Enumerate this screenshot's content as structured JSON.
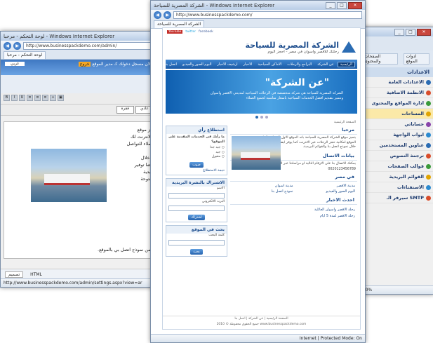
{
  "left_window": {
    "title": "لوحة التحكم - مرحبا - Windows Internet Explorer",
    "address": "http://www.businesspackdemo.com/admin/",
    "tab_label": "http://www.businesspackdemo.com",
    "tab2_label": "لوحة التحكم - مرحبا",
    "language_value": "عربي",
    "logged_in_text": "انت الان مسجل دخولك كـ مدير الموقع",
    "logout_label": "خروج",
    "format_value": "فقرة",
    "font_value": "خط عادي",
    "editor_lines": [
      "يتميز موقع",
      "ثر الانترنت لك",
      "بالعملاء للتواصل",
      "يتم ",
      "من خلال",
      "و ايضا توفير",
      "البريدية",
      "المفتوحة"
    ],
    "editor_footer": "الة من نموذج اتصل بي بالموقع.",
    "bottom_tabs": [
      "تصميم",
      "HTML"
    ],
    "status_url": "http://www.businesspackdemo.com/admin/settings.aspx?view=ar"
  },
  "right_window": {
    "menu": [
      "الصفحات والمحتوى",
      "ادوات الموقع"
    ],
    "section_title": "الاعدادات",
    "items": [
      {
        "label": "الاعدادات العامة",
        "color": "#2b6cb3"
      },
      {
        "label": "الانظمة الاضافية",
        "color": "#d94c2a"
      },
      {
        "label": "ادارة المواقع والمحتوى",
        "color": "#3a9a3a"
      },
      {
        "label": "المساحات",
        "color": "#e0a400"
      },
      {
        "label": "حساباتي",
        "color": "#8844aa"
      },
      {
        "label": "ابواب الواجهة",
        "color": "#2b8ad0"
      },
      {
        "label": "عناوين المستخدمين",
        "color": "#2b6cb3"
      },
      {
        "label": "ترجمة النصوص",
        "color": "#d94c2a"
      },
      {
        "label": "قوالب الصفحات",
        "color": "#3a9a3a"
      },
      {
        "label": "القوائم البريدية",
        "color": "#e0a400"
      },
      {
        "label": "الاستفتاءات",
        "color": "#2b8ad0"
      },
      {
        "label": "سيرفر الـ SMTP",
        "color": "#d94c2a"
      }
    ],
    "zoom": "100%"
  },
  "main_window": {
    "title": "الشركة المصرية للسياحة - Windows Internet Explorer",
    "address": "http://www.businesspackdemo.com/",
    "tab_label": "الشركة المصرية للسياحة",
    "site": {
      "social": [
        "YouTube",
        "twitter",
        "facebook"
      ],
      "logo_title": "الشركة المصرية للسياحة",
      "logo_sub": "رحلتك للاقصر واسوان في مصر - احجز اليوم",
      "nav": [
        "الرئيسية",
        "عن الشركة",
        "البرامج والرحلات",
        "الاماكن السياحية",
        "الاخبار",
        "ارشيف الاخبار",
        "البوم الصور والفيديو",
        "اتصل بنا"
      ],
      "hero_title": "\"عن الشركة\"",
      "hero_text": "الشركة المصرية للسياحة هي شركة متخصصة في الرحلات السياحية لمدينتي الاقصر واسوان ونتميز بتقديم افضل الخدمات السياحية باسعار مناسبة لجميع العملاء",
      "breadcrumb": "الصفحة الرئيسية",
      "welcome_title": "مرحبا",
      "welcome_text": "يتميز موقع الشركة المصرية للسياحة بانه الموقع الاول للرحلات النيلية في مصر ويوفر الموقع امكانية حجز الرحلات عبر الانترنت كما يوفر ايضا وسائل التواصل مع العملاء من خلال نموذج اتصل بنا والقوائم البريدية.",
      "contact_title": "بيانات الاتصال",
      "contact_text": "يمكنك الاتصال بنا على الارقام التالية او مراسلتنا عبر البريد الالكتروني",
      "phone": "0020123456789",
      "cities_title": "في مصر",
      "cities": [
        "مدينة الاقصر",
        "مدينة اسوان",
        "البوم الصور والفيديو",
        "نموذج اتصل بنا"
      ],
      "news_title": "احدث الاخبار",
      "news": [
        "رحلة الاقصر واسوان العائلية",
        "رحلة الاقصر لمدة 5 ايام"
      ],
      "poll_title": "استطلاع رأي",
      "poll_question": "ما رأيك في الخدمات المقدمة على الموقع؟",
      "poll_options": [
        "جيد جدا",
        "جيد",
        "مقبول"
      ],
      "poll_button": "صوت",
      "poll_results": "نتيجة الاستطلاع",
      "mail_title": "الاشتراك بالنشرة البريدية",
      "mail_name": "الاسم",
      "mail_email": "البريد الالكتروني",
      "mail_button": "اشتراك",
      "search_title": "بحث في الموقع",
      "search_label": "كلمة البحث",
      "search_button": "بحث",
      "footer_links": "الصفحة الرئيسية | عن الشركة | اتصل بنا",
      "footer_copy": "جميع الحقوق محفوظة © 2010",
      "footer_domain": "www.businesspackdemo.com"
    },
    "status": "Internet | Protected Mode: On"
  }
}
